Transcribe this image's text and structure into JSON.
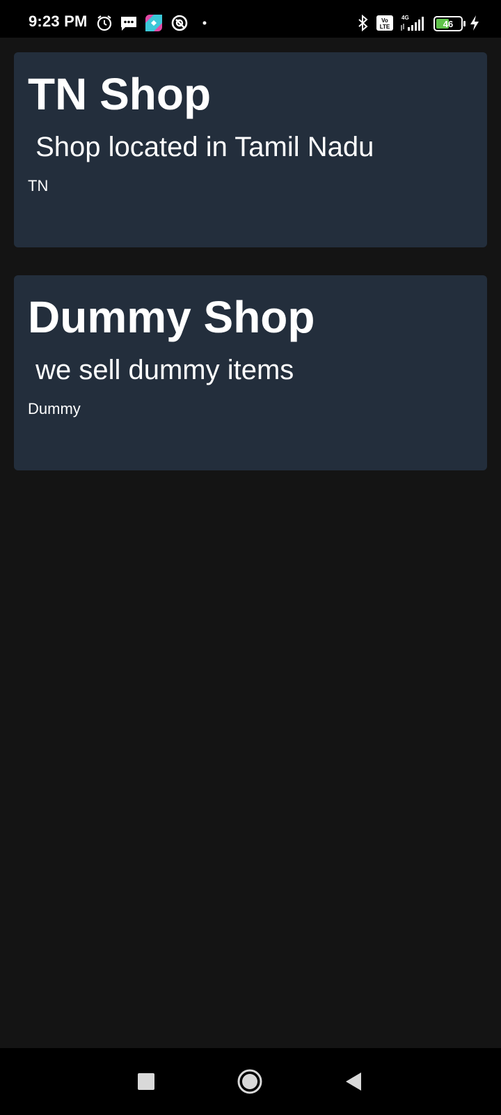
{
  "status_bar": {
    "time": "9:23 PM",
    "battery": "46",
    "network": "4G",
    "volte": "Vo LTE",
    "left_icons": [
      "alarm-icon",
      "messages-icon",
      "app-icon",
      "data-saver-icon",
      "dot-icon"
    ],
    "right_icons": [
      "bluetooth-icon",
      "volte-icon",
      "signal-icon",
      "battery-icon",
      "charging-icon"
    ]
  },
  "shops": [
    {
      "name": "TN Shop",
      "description": " Shop located in Tamil Nadu",
      "code": "TN"
    },
    {
      "name": "Dummy Shop",
      "description": " we sell dummy items",
      "code": "Dummy"
    }
  ],
  "nav_bar": {
    "buttons": [
      "recents-button",
      "home-button",
      "back-button"
    ]
  },
  "colors": {
    "background": "#141414",
    "card": "#232e3c",
    "text": "#ffffff",
    "bars": "#000000",
    "battery_fill": "#5fc34a"
  }
}
